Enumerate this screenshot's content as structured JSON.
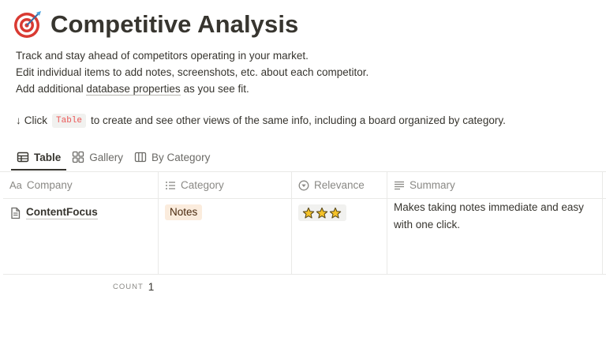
{
  "page": {
    "title": "Competitive Analysis",
    "icon": "target-icon",
    "description": {
      "line1": "Track and stay ahead of competitors operating in your market.",
      "line2": "Edit individual items to add notes, screenshots, etc. about each competitor.",
      "line3_before": "Add additional",
      "line3_link": "database properties",
      "line3_after": "as you see fit."
    },
    "hint": {
      "arrow": "↓",
      "before": "Click",
      "code": "Table",
      "after": "to create and see other views of the same info, including a board organized by category."
    }
  },
  "tabs": [
    {
      "label": "Table",
      "icon": "table-icon",
      "active": true
    },
    {
      "label": "Gallery",
      "icon": "gallery-icon",
      "active": false
    },
    {
      "label": "By Category",
      "icon": "board-icon",
      "active": false
    }
  ],
  "table": {
    "columns": {
      "company": {
        "label": "Company",
        "icon_text": "Aa"
      },
      "category": {
        "label": "Category",
        "icon": "list-icon"
      },
      "relevance": {
        "label": "Relevance",
        "icon": "select-icon"
      },
      "summary": {
        "label": "Summary",
        "icon": "text-icon"
      }
    },
    "rows": [
      {
        "company": "ContentFocus",
        "category": "Notes",
        "relevance": "⭐⭐⭐",
        "summary": "Makes taking notes immediate and easy with one click."
      }
    ],
    "count_label": "COUNT",
    "count_value": "1"
  },
  "colors": {
    "text": "#37352f",
    "muted": "#8a8985",
    "tag_bg": "#fbecdd",
    "code_red": "#eb5757",
    "target_red": "#d93a32",
    "star_yellow": "#f5c227"
  }
}
